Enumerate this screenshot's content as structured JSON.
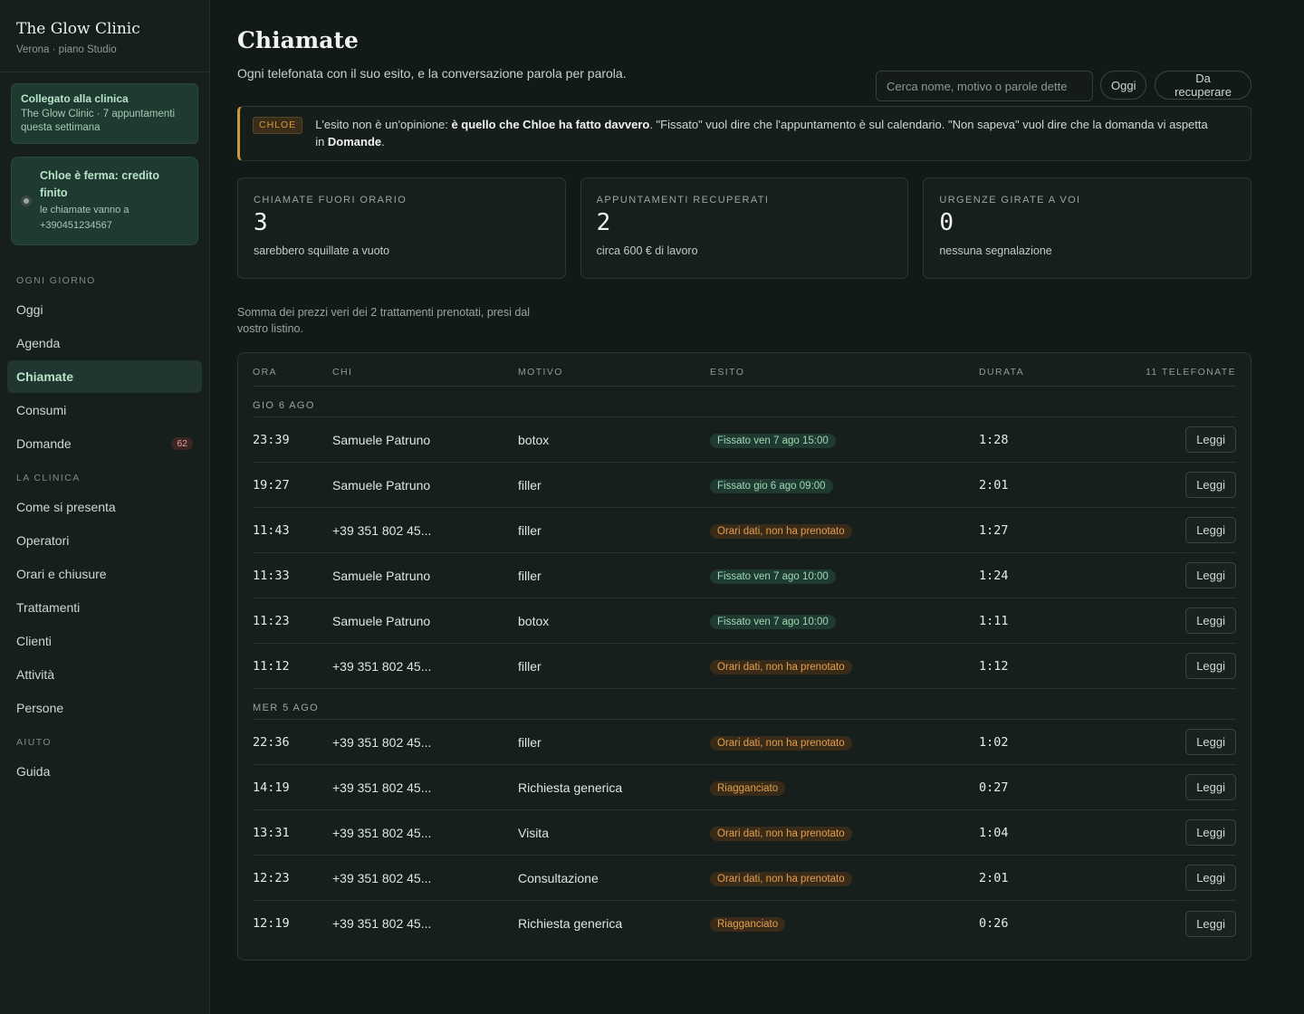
{
  "brand": {
    "name": "The Glow Clinic",
    "sub": "Verona · piano Studio"
  },
  "connected": {
    "title": "Collegato alla clinica",
    "sub": "The Glow Clinic · 7 appuntamenti questa settimana"
  },
  "stopped": {
    "title": "Chloe è ferma: credito finito",
    "sub": "le chiamate vanno a +390451234567"
  },
  "nav": {
    "sections": [
      {
        "label": "OGNI GIORNO",
        "items": [
          {
            "label": "Oggi"
          },
          {
            "label": "Agenda"
          },
          {
            "label": "Chiamate",
            "active": true
          },
          {
            "label": "Consumi"
          },
          {
            "label": "Domande",
            "badge": "62"
          }
        ]
      },
      {
        "label": "LA CLINICA",
        "items": [
          {
            "label": "Come si presenta"
          },
          {
            "label": "Operatori"
          },
          {
            "label": "Orari e chiusure"
          },
          {
            "label": "Trattamenti"
          },
          {
            "label": "Clienti"
          },
          {
            "label": "Attività"
          },
          {
            "label": "Persone"
          }
        ]
      },
      {
        "label": "AIUTO",
        "items": [
          {
            "label": "Guida"
          }
        ]
      }
    ]
  },
  "header": {
    "title": "Chiamate",
    "subtitle": "Ogni telefonata con il suo esito, e la conversazione parola per parola.",
    "search_placeholder": "Cerca nome, motivo o parole dette",
    "filter_today": "Oggi",
    "filter_recover": "Da recuperare"
  },
  "notice": {
    "tag": "CHLOE",
    "p1": "L'esito non è un'opinione: ",
    "b1": "è quello che Chloe ha fatto davvero",
    "p2": ". \"Fissato\" vuol dire che l'appuntamento è sul calendario. \"Non sapeva\" vuol dire che la domanda vi aspetta in ",
    "b2": "Domande",
    "p3": "."
  },
  "stats": [
    {
      "label": "CHIAMATE FUORI ORARIO",
      "value": "3",
      "note": "sarebbero squillate a vuoto"
    },
    {
      "label": "APPUNTAMENTI RECUPERATI",
      "value": "2",
      "note": "circa 600 € di lavoro"
    },
    {
      "label": "URGENZE GIRATE A VOI",
      "value": "0",
      "note": "nessuna segnalazione"
    }
  ],
  "sum_note": "Somma dei prezzi veri dei 2 trattamenti prenotati, presi dal vostro listino.",
  "table": {
    "columns": [
      "ORA",
      "CHI",
      "MOTIVO",
      "ESITO",
      "DURATA",
      "11 TELEFONATE"
    ],
    "action_label": "Leggi",
    "colors": {
      "ok": "#9fd7b6",
      "warn": "#e0a050"
    },
    "groups": [
      {
        "label": "GIO 6 AGO",
        "rows": [
          {
            "time": "23:39",
            "who": "Samuele Patruno",
            "reason": "botox",
            "outcome": "Fissato ven 7 ago 15:00",
            "kind": "ok",
            "duration": "1:28"
          },
          {
            "time": "19:27",
            "who": "Samuele Patruno",
            "reason": "filler",
            "outcome": "Fissato gio 6 ago 09:00",
            "kind": "ok",
            "duration": "2:01"
          },
          {
            "time": "11:43",
            "who": "+39 351 802 45...",
            "reason": "filler",
            "outcome": "Orari dati, non ha prenotato",
            "kind": "warn",
            "duration": "1:27"
          },
          {
            "time": "11:33",
            "who": "Samuele Patruno",
            "reason": "filler",
            "outcome": "Fissato ven 7 ago 10:00",
            "kind": "ok",
            "duration": "1:24"
          },
          {
            "time": "11:23",
            "who": "Samuele Patruno",
            "reason": "botox",
            "outcome": "Fissato ven 7 ago 10:00",
            "kind": "ok",
            "duration": "1:11"
          },
          {
            "time": "11:12",
            "who": "+39 351 802 45...",
            "reason": "filler",
            "outcome": "Orari dati, non ha prenotato",
            "kind": "warn",
            "duration": "1:12"
          }
        ]
      },
      {
        "label": "MER 5 AGO",
        "rows": [
          {
            "time": "22:36",
            "who": "+39 351 802 45...",
            "reason": "filler",
            "outcome": "Orari dati, non ha prenotato",
            "kind": "warn",
            "duration": "1:02"
          },
          {
            "time": "14:19",
            "who": "+39 351 802 45...",
            "reason": "Richiesta generica",
            "outcome": "Riagganciato",
            "kind": "warn",
            "duration": "0:27"
          },
          {
            "time": "13:31",
            "who": "+39 351 802 45...",
            "reason": "Visita",
            "outcome": "Orari dati, non ha prenotato",
            "kind": "warn",
            "duration": "1:04"
          },
          {
            "time": "12:23",
            "who": "+39 351 802 45...",
            "reason": "Consultazione",
            "outcome": "Orari dati, non ha prenotato",
            "kind": "warn",
            "duration": "2:01"
          },
          {
            "time": "12:19",
            "who": "+39 351 802 45...",
            "reason": "Richiesta generica",
            "outcome": "Riagganciato",
            "kind": "warn",
            "duration": "0:26"
          }
        ]
      }
    ]
  }
}
